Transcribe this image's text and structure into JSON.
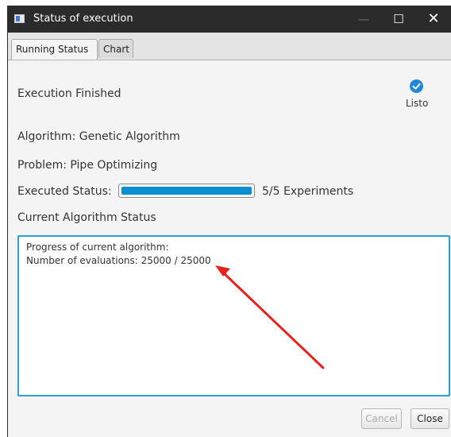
{
  "window": {
    "title": "Status of execution",
    "minimize_glyph": "—",
    "maximize_glyph": "☐",
    "close_glyph": "✕"
  },
  "tabs": [
    {
      "label": "Running Status",
      "selected": true
    },
    {
      "label": "Chart",
      "selected": false
    }
  ],
  "status": {
    "execution_label": "Execution Finished",
    "badge_label": "Listo",
    "badge_icon": "check-circle-icon",
    "badge_color": "#1e88d6"
  },
  "details": {
    "algorithm": "Algorithm:  Genetic Algorithm",
    "problem": "Problem:  Pipe Optimizing",
    "executed_label": "Executed Status:",
    "executed_count": "5/5  Experiments",
    "progress_fraction": 1.0,
    "progress_color": "#0b8ed0"
  },
  "current_status": {
    "heading": "Current Algorithm Status",
    "line1": "Progress of current algorithm:",
    "line2": "Number of evaluations: 25000 / 25000"
  },
  "buttons": {
    "cancel": "Cancel",
    "close": "Close"
  },
  "annotation": {
    "arrow_color": "#e8211d"
  }
}
